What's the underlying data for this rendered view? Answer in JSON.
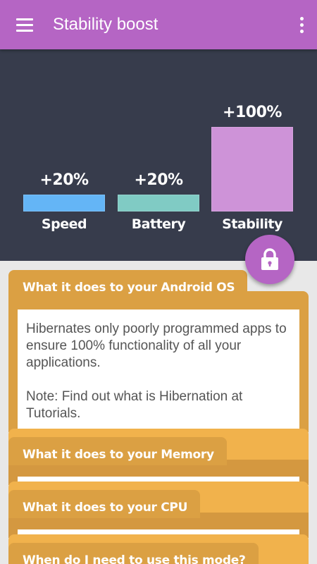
{
  "app_bar": {
    "title": "Stability boost",
    "menu_icon": "hamburger-menu-icon",
    "more_icon": "more-vertical-icon"
  },
  "boost_chart": {
    "bars": [
      {
        "label": "Speed",
        "value_text": "+20%",
        "value": 20,
        "color": "#64b5f6"
      },
      {
        "label": "Battery",
        "value_text": "+20%",
        "value": 20,
        "color": "#80cbc4"
      },
      {
        "label": "Stability",
        "value_text": "+100%",
        "value": 100,
        "color": "#ce93d8"
      }
    ]
  },
  "lock_button": {
    "icon": "lock-icon",
    "color": "#b565c4"
  },
  "sections": [
    {
      "title": "What it does to your Android OS",
      "body": "Hibernates only poorly programmed apps to ensure 100% functionality of all your applications.",
      "note": "Note: Find out what is Hibernation at Tutorials."
    },
    {
      "title": "What it does to your Memory"
    },
    {
      "title": "What it does to your CPU"
    },
    {
      "title": "When do I need to use this mode?"
    }
  ],
  "colors": {
    "app_bar": "#b565c4",
    "chart_bg": "#373c4c",
    "card": "#dba043",
    "card_tab_light": "#f1b24c"
  }
}
